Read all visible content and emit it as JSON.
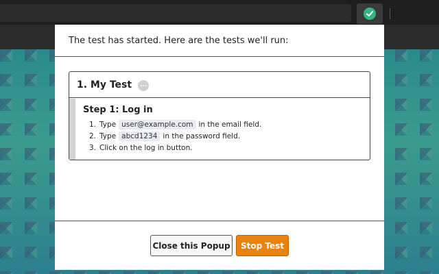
{
  "browser": {
    "extension_icon": "checkmark-icon",
    "extension_color": "#36b37e"
  },
  "popup": {
    "header_text": "The test has started. Here are the tests we'll run:",
    "test": {
      "title": "1. My Test",
      "status_icon": "pending-dots-icon",
      "step": {
        "title": "Step 1: Log in",
        "items": [
          {
            "num": "1.",
            "before": "Type",
            "code": "user@example.com",
            "after": "in the email field."
          },
          {
            "num": "2.",
            "before": "Type",
            "code": "abcd1234",
            "after": "in the password field."
          },
          {
            "num": "3.",
            "before": "Click on the log in button.",
            "code": "",
            "after": ""
          }
        ]
      }
    },
    "buttons": {
      "close_label": "Close this Popup",
      "stop_label": "Stop Test"
    },
    "colors": {
      "stop_button": "#e8830f"
    }
  }
}
